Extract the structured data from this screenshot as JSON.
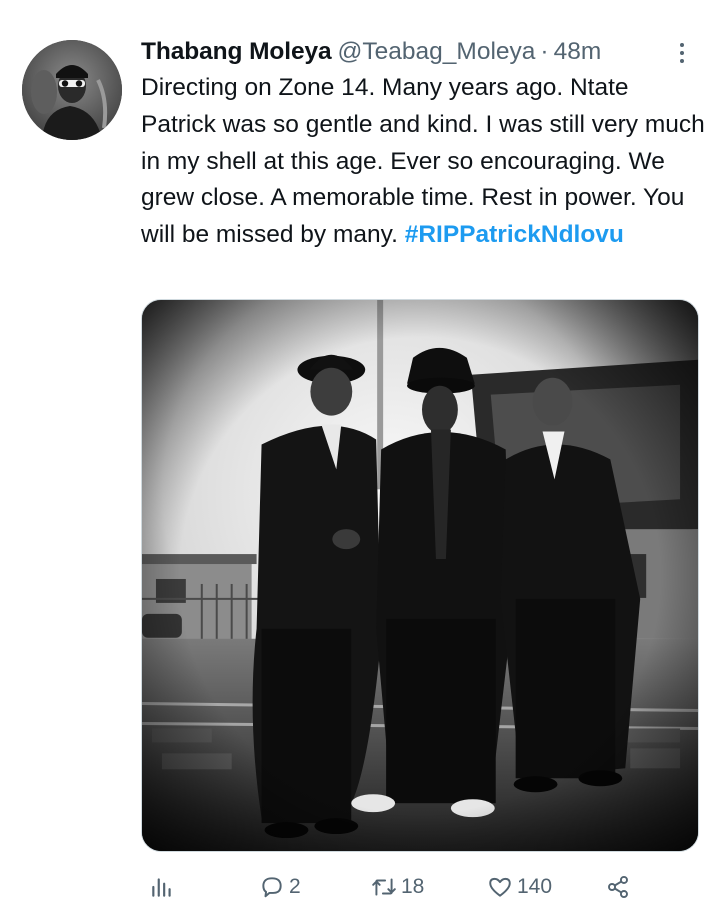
{
  "tweet": {
    "author": {
      "display_name": "Thabang Moleya",
      "handle": "@Teabag_Moleya",
      "separator": "·",
      "timestamp": "48m"
    },
    "text": "Directing on Zone 14. Many years ago. Ntate Patrick was so gentle and kind. I was still very much in my shell at this age. Ever so encouraging. We grew close. A memorable time. Rest in power. You will be missed by many. ",
    "hashtag": "#RIPPatrickNdlovu",
    "media": {
      "kind": "black-and-white photo"
    },
    "actions": {
      "analytics": {
        "icon": "analytics-icon"
      },
      "reply": {
        "icon": "reply-icon",
        "count": "2"
      },
      "retweet": {
        "icon": "retweet-icon",
        "count": "18"
      },
      "like": {
        "icon": "heart-icon",
        "count": "140"
      },
      "share": {
        "icon": "share-icon"
      }
    }
  },
  "colors": {
    "text": "#0f1419",
    "secondary": "#536471",
    "link": "#1d9bf0",
    "border": "#cfd9de"
  }
}
